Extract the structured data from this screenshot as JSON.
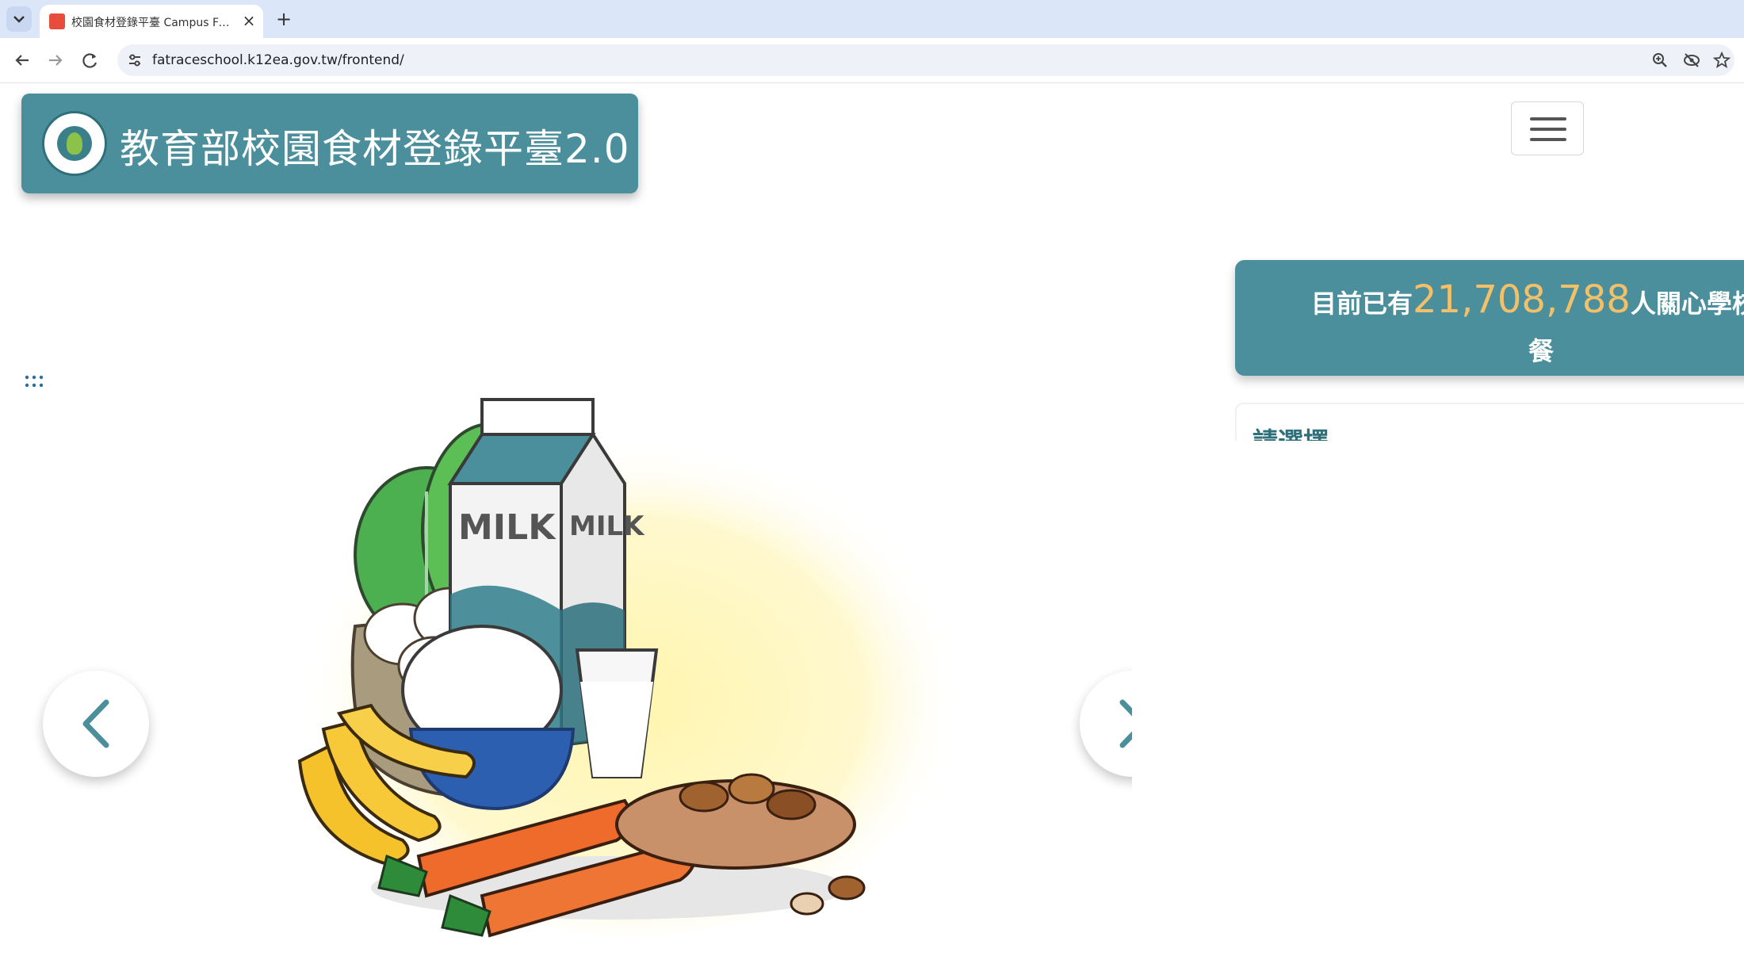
{
  "browser": {
    "tab_title": "校園食材登錄平臺 Campus Food",
    "tab_close": "×",
    "new_tab": "+",
    "url": "fatraceschool.k12ea.gov.tw/frontend/"
  },
  "header": {
    "site_title": "教育部校園食材登錄平臺2.0"
  },
  "counter": {
    "prefix": "目前已有",
    "number": "21,708,788",
    "suffix": "人關心學校午",
    "suffix_line2": "餐"
  },
  "select_panel": {
    "label": "請選擇"
  },
  "illustration": {
    "milk_label": "MILK"
  },
  "colors": {
    "teal": "#4a8f9b",
    "counter_number": "#f3c06a",
    "tab_bar": "#dbe6f8"
  }
}
